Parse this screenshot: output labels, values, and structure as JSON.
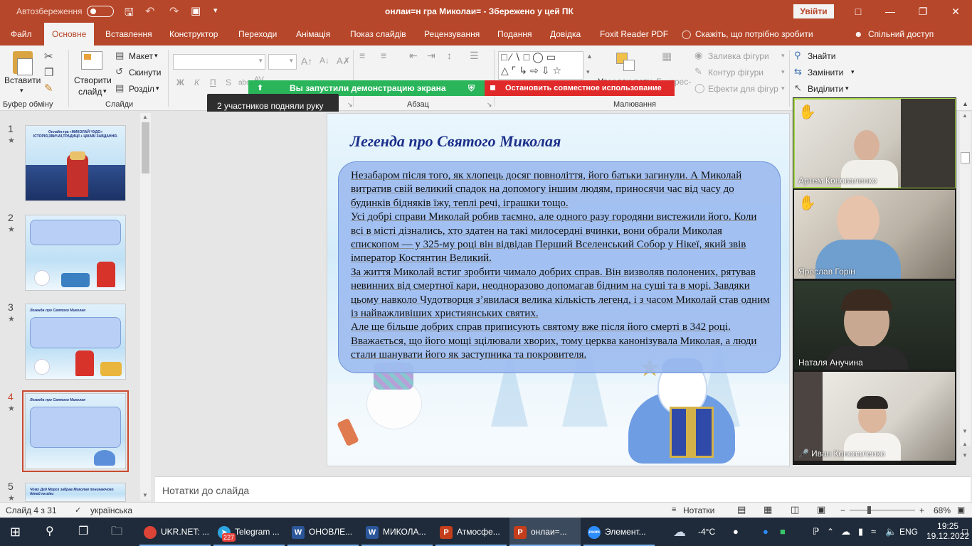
{
  "titlebar": {
    "autosave": "Автозбереження",
    "doc_title": "онлаи=н гра Миколаи= - Збережено у цей ПК",
    "signin": "Увійти",
    "undo_icon": "undo-icon",
    "save_icon": "save-icon"
  },
  "tabs": [
    "Файл",
    "Основне",
    "Вставлення",
    "Конструктор",
    "Переходи",
    "Анімація",
    "Показ слайдів",
    "Рецензування",
    "Подання",
    "Довідка",
    "Foxit Reader PDF",
    "Скажіть, що потрібно зробити",
    "Спільний доступ"
  ],
  "ribbon": {
    "paste": "Вставити",
    "new_slide": "Створити",
    "new_slide2": "слайд",
    "layout": "Макет",
    "reset": "Скинути",
    "section": "Розділ",
    "group_clipboard": "Буфер обміну",
    "group_slides": "Слайди",
    "group_paragraph": "Абзац",
    "group_drawing": "Малювання",
    "format_b": "Ж",
    "format_i": "К",
    "format_u": "П",
    "format_s": "S",
    "arrange": "Упорядкувати",
    "quick_styles": "Експрес-",
    "shape_fill": "Заливка фігури",
    "shape_outline": "Контур фігури",
    "shape_effects": "Ефекти для фігур",
    "find": "Знайти",
    "replace": "Замінити",
    "select": "Виділити"
  },
  "zoom": {
    "share_msg": "Вы запустили демонстрацию экрана",
    "stop_share": "Остановить совместное использование",
    "tooltip": "2 участников подняли руку",
    "participants": [
      {
        "name": "Артем Коноваленко",
        "hand": true
      },
      {
        "name": "Ярослав Горін",
        "hand": true
      },
      {
        "name": "Наталя Анучина",
        "hand": false
      },
      {
        "name": "Иван Коноваленко",
        "hand": false,
        "muted": true
      }
    ]
  },
  "thumbnails": [
    {
      "num": "1",
      "title": "Онлайн-гра «МИКОЛАЙ ЧУДО» ІСТОРІЯ,ЗВИЧАЇ,ТРАДИЦІЇ + ЦІКАВІ ЗАВДАННЯ."
    },
    {
      "num": "2",
      "title": ""
    },
    {
      "num": "3",
      "title": "Легенда про Святого Миколая"
    },
    {
      "num": "4",
      "title": "Легенда про Святого Миколая"
    },
    {
      "num": "5",
      "title": "Чому Дед Мороз забрав Миколая поникаючого дітей на віки"
    }
  ],
  "slide": {
    "title": "Легенда про Святого Миколая",
    "paragraphs": [
      "Незабаром після того, як хлопець досяг повноліття, його батьки загинули. А Миколай витратив свій великий спадок на допомогу іншим людям, приносячи час від часу до будинків бідняків їжу, теплі речі, іграшки тощо.",
      "Усі добрі справи Миколай робив таємно, але одного разу городяни вистежили його. Коли всі в місті дізнались, хто здатен на такі милосердні вчинки, вони обрали Миколая єпископом — у 325-му році він відвідав Перший Вселенський Собор у Нікеї, який звів імператор Костянтин Великий.",
      "За життя Миколай встиг зробити чимало добрих справ. Він визволяв полонених, рятував невинних від смертної кари, неодноразово допомагав бідним на суші та в морі. Завдяки цьому навколо Чудотворця з’явилася велика кількість легенд, і з часом Миколай став одним із найважливіших християнських святих.",
      "Але ще більше добрих справ приписують святому вже після його смерті в 342 році. Вважається, що його мощі зцілювали хворих, тому церква канонізувала Миколая, а люди стали шанувати його як заступника та покровителя."
    ]
  },
  "notes": "Нотатки до слайда",
  "status": {
    "slide_counter": "Слайд 4 з 31",
    "language": "українська",
    "notes_btn": "Нотатки",
    "zoom": "68%"
  },
  "taskbar": {
    "items": [
      "UKR.NET: ...",
      "Telegram ...",
      "ОНОВЛЕ...",
      "МИКОЛА...",
      "Атмосфе...",
      "онлаи=...",
      "Элемент..."
    ],
    "telegram_badge": "227",
    "temp": "-4°C",
    "lang": "ENG",
    "time": "19:25",
    "date": "19.12.2022"
  }
}
